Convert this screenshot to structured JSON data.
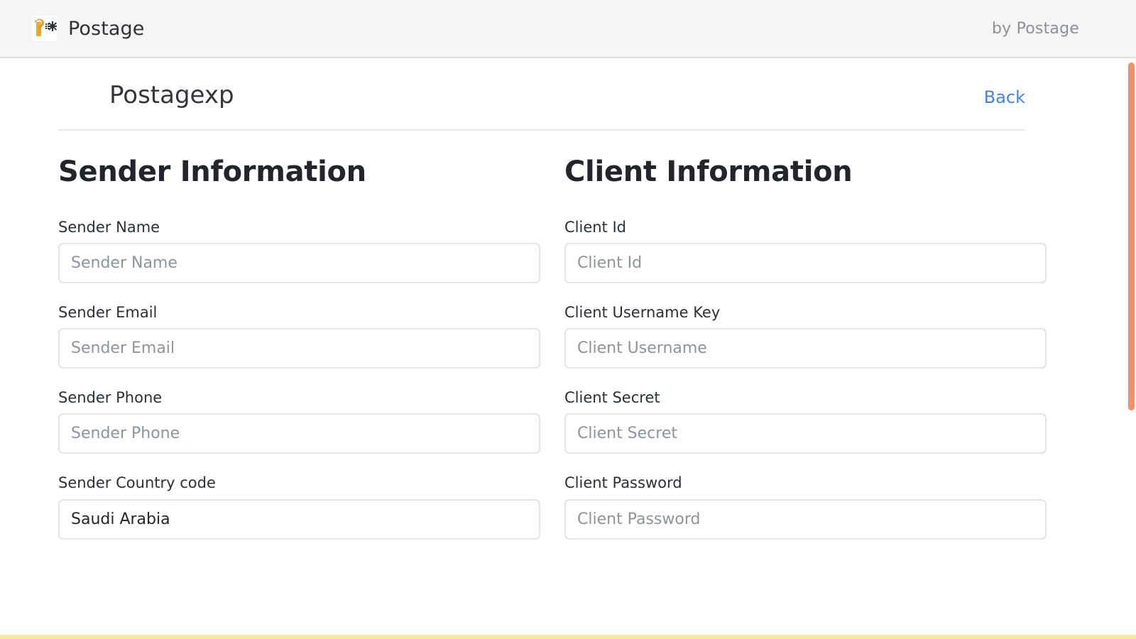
{
  "appbar": {
    "logo_icon": "postage-logo-icon",
    "brand_name": "Postage",
    "attribution": "by Postage"
  },
  "page": {
    "title": "Postagexp",
    "back_label": "Back"
  },
  "sender_section": {
    "heading": "Sender Information",
    "fields": [
      {
        "label": "Sender Name",
        "placeholder": "Sender Name",
        "value": "",
        "type": "text"
      },
      {
        "label": "Sender Email",
        "placeholder": "Sender Email",
        "value": "",
        "type": "text"
      },
      {
        "label": "Sender Phone",
        "placeholder": "Sender Phone",
        "value": "",
        "type": "text"
      },
      {
        "label": "Sender Country code",
        "placeholder": "",
        "value": "Saudi Arabia",
        "type": "select"
      }
    ]
  },
  "client_section": {
    "heading": "Client Information",
    "fields": [
      {
        "label": "Client Id",
        "placeholder": "Client Id",
        "value": "",
        "type": "text"
      },
      {
        "label": "Client Username Key",
        "placeholder": "Client Username",
        "value": "",
        "type": "text"
      },
      {
        "label": "Client Secret",
        "placeholder": "Client Secret",
        "value": "",
        "type": "text"
      },
      {
        "label": "Client Password",
        "placeholder": "Client Password",
        "value": "",
        "type": "text"
      }
    ]
  },
  "scrollbar": {
    "name": "vertical-scrollbar",
    "thumb_color": "#f0916c"
  },
  "colors": {
    "accent_link": "#3d84f7",
    "appbar_bg": "#f5f5f5",
    "border": "#e2e5ea",
    "bottom_strip": "#f5e99a"
  }
}
